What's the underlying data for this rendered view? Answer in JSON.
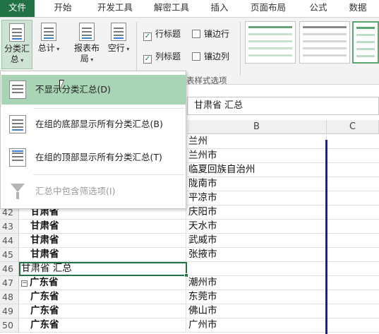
{
  "tabs": [
    "文件",
    "开始",
    "开发工具",
    "解密工具",
    "插入",
    "页面布局",
    "公式",
    "数据"
  ],
  "ribbon": {
    "subtotal": "分类汇总",
    "grand_total": "总计",
    "report_layout": "报表布局",
    "blank_rows": "空行",
    "row_headers": "行标题",
    "col_headers": "列标题",
    "banded_rows": "镶边行",
    "banded_cols": "镶边列",
    "group_label": "表样式选项"
  },
  "formula_bar": {
    "value": "甘肃省 汇总"
  },
  "columns": [
    "B",
    "C"
  ],
  "menu": {
    "items": [
      "不显示分类汇总(D)",
      "在组的底部显示所有分类汇总(B)",
      "在组的顶部显示所有分类汇总(T)",
      "汇总中包含筛选项(I)"
    ]
  },
  "rows": [
    {
      "num": "",
      "a": "",
      "b": "兰州"
    },
    {
      "num": "",
      "a": "",
      "b": "兰州市"
    },
    {
      "num": "",
      "a": "",
      "b": "临夏回族自治州"
    },
    {
      "num": "",
      "a": "",
      "b": "陇南市"
    },
    {
      "num": "",
      "a": "",
      "b": "平凉市"
    },
    {
      "num": "42",
      "a": "甘肃省",
      "b": "庆阳市"
    },
    {
      "num": "43",
      "a": "甘肃省",
      "b": "天水市"
    },
    {
      "num": "44",
      "a": "甘肃省",
      "b": "武威市"
    },
    {
      "num": "45",
      "a": "甘肃省",
      "b": "张掖市"
    },
    {
      "num": "46",
      "a": "甘肃省 汇总",
      "b": ""
    },
    {
      "num": "47",
      "a": "广东省",
      "b": "潮州市"
    },
    {
      "num": "48",
      "a": "广东省",
      "b": "东莞市"
    },
    {
      "num": "49",
      "a": "广东省",
      "b": "佛山市"
    },
    {
      "num": "50",
      "a": "广东省",
      "b": "广州市"
    }
  ],
  "colors": {
    "accent": "#217346",
    "menu_hover": "#a9d4b5",
    "page_break": "#1f1f9a"
  }
}
